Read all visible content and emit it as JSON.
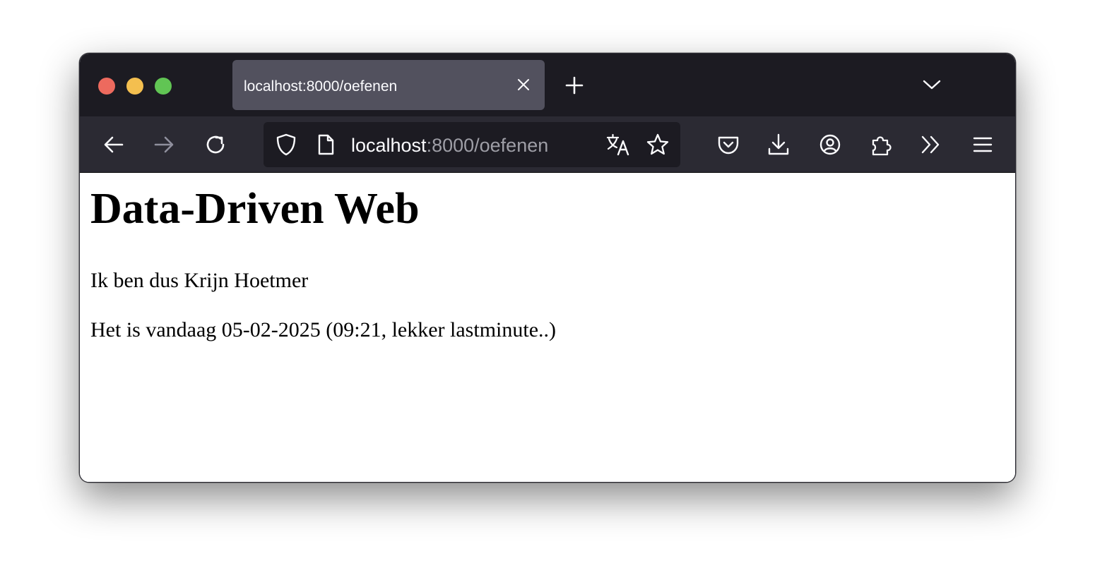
{
  "tab": {
    "title": "localhost:8000/oefenen"
  },
  "urlbar": {
    "host": "localhost",
    "rest": ":8000/oefenen"
  },
  "toolbar": {
    "back_icon": "arrow-left-icon",
    "forward_icon": "arrow-right-icon",
    "reload_icon": "reload-icon",
    "shield_icon": "shield-icon",
    "page_icon": "page-icon",
    "translate_icon": "translate-icon",
    "bookmark_icon": "star-icon",
    "pocket_icon": "pocket-icon",
    "download_icon": "download-icon",
    "account_icon": "account-icon",
    "extensions_icon": "puzzle-icon",
    "overflow_icon": "chevrons-right-icon",
    "menu_icon": "hamburger-menu-icon"
  },
  "page": {
    "heading": "Data-Driven Web",
    "line1": "Ik ben dus Krijn Hoetmer",
    "line2": "Het is vandaag 05-02-2025 (09:21, lekker lastminute..)"
  },
  "colors": {
    "tabbar_bg": "#1c1b22",
    "navbar_bg": "#2b2a33",
    "active_tab_bg": "#52515e",
    "url_dim_text": "#9e9ea6"
  }
}
